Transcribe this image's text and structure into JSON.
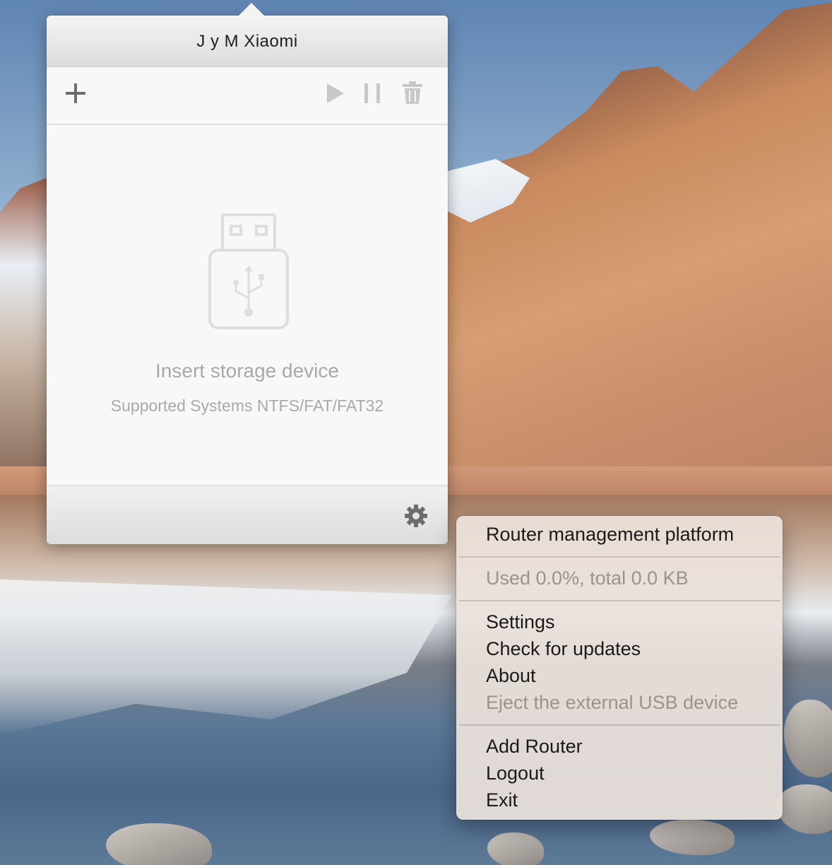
{
  "popover": {
    "title": "J y M Xiaomi",
    "toolbar": {
      "add_icon": "plus-icon",
      "play_icon": "play-icon",
      "pause_icon": "pause-icon",
      "delete_icon": "trash-icon"
    },
    "empty_state": {
      "icon": "usb-drive-icon",
      "title": "Insert storage device",
      "subtitle": "Supported Systems NTFS/FAT/FAT32"
    },
    "footer": {
      "settings_icon": "gear-icon"
    }
  },
  "menu": {
    "header": "Router management platform",
    "storage_status": "Used 0.0%, total 0.0 KB",
    "items": [
      {
        "label": "Settings",
        "enabled": true
      },
      {
        "label": "Check for updates",
        "enabled": true
      },
      {
        "label": "About",
        "enabled": true
      },
      {
        "label": "Eject the external USB device",
        "enabled": false
      }
    ],
    "account_items": [
      {
        "label": "Add Router",
        "enabled": true
      },
      {
        "label": "Logout",
        "enabled": true
      },
      {
        "label": "Exit",
        "enabled": true
      }
    ]
  },
  "colors": {
    "toolbar_icon_active": "#6d6d6d",
    "toolbar_icon_disabled": "#c8c8c8",
    "empty_text": "#a9a9a9",
    "menu_background": "#ece2dc",
    "menu_disabled_text": "#9a9390"
  }
}
